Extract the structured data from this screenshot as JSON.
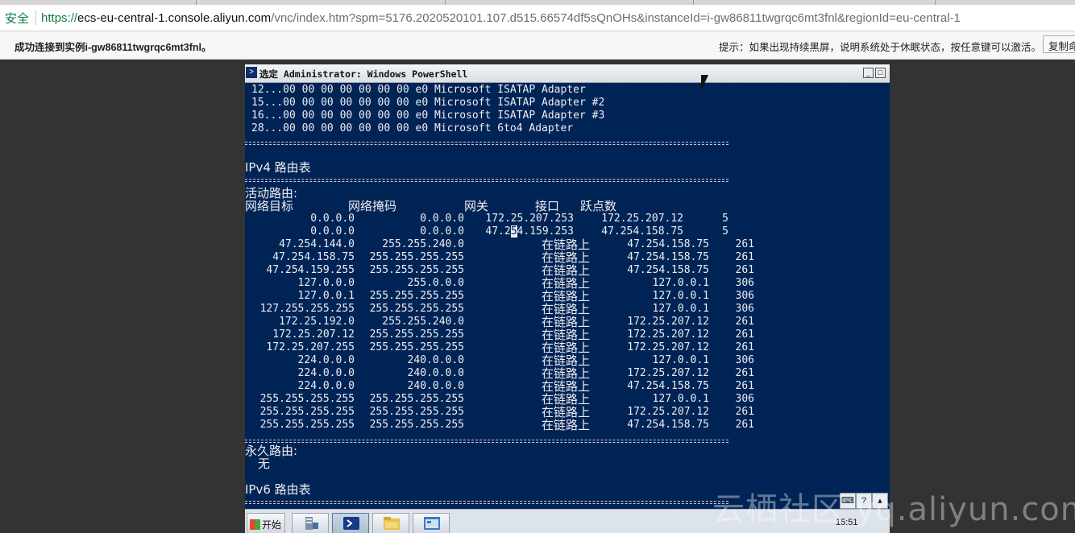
{
  "browser": {
    "secure_label": "安全",
    "url_scheme": "https://",
    "url_host": "ecs-eu-central-1.console.aliyun.com",
    "url_rest": "/vnc/index.htm?spm=5176.2020520101.107.d515.66574df5sQnOHs&instanceId=i-gw86811twgrqc6mt3fnl&regionId=eu-central-1"
  },
  "infobar": {
    "connected": "成功连接到实例i-gw86811twgrqc6mt3fnl。",
    "tip": "提示：如果出现持续黑屏，说明系统处于休眠状态，按任意键可以激活。",
    "copy_button": "复制命令"
  },
  "powershell": {
    "title": "选定 Administrator: Windows PowerShell",
    "adapters": [
      "12...00 00 00 00 00 00 00 e0 Microsoft ISATAP Adapter",
      "15...00 00 00 00 00 00 00 e0 Microsoft ISATAP Adapter #2",
      "16...00 00 00 00 00 00 00 e0 Microsoft ISATAP Adapter #3",
      "28...00 00 00 00 00 00 00 e0 Microsoft 6to4 Adapter"
    ],
    "separator": "===========================================================================",
    "ipv4_title": "IPv4 路由表",
    "active_routes": "活动路由:",
    "headers": {
      "dest": "网络目标",
      "mask": "网络掩码",
      "gateway": "网关",
      "iface": "接口",
      "metric": "跃点数"
    },
    "default_routes": [
      {
        "dest": "0.0.0.0",
        "mask": "0.0.0.0",
        "gateway": "172.25.207.253",
        "iface": "172.25.207.12",
        "metric": "5"
      },
      {
        "dest": "0.0.0.0",
        "mask": "0.0.0.0",
        "gateway_before": "47.2",
        "gateway_cursor": "5",
        "gateway_after": "4.159.253",
        "iface": "47.254.158.75",
        "metric": "5"
      }
    ],
    "onlink": "在链路上",
    "routes": [
      {
        "dest": "47.254.144.0",
        "mask": "255.255.240.0",
        "iface": "47.254.158.75",
        "metric": "261"
      },
      {
        "dest": "47.254.158.75",
        "mask": "255.255.255.255",
        "iface": "47.254.158.75",
        "metric": "261"
      },
      {
        "dest": "47.254.159.255",
        "mask": "255.255.255.255",
        "iface": "47.254.158.75",
        "metric": "261"
      },
      {
        "dest": "127.0.0.0",
        "mask": "255.0.0.0",
        "iface": "127.0.0.1",
        "metric": "306"
      },
      {
        "dest": "127.0.0.1",
        "mask": "255.255.255.255",
        "iface": "127.0.0.1",
        "metric": "306"
      },
      {
        "dest": "127.255.255.255",
        "mask": "255.255.255.255",
        "iface": "127.0.0.1",
        "metric": "306"
      },
      {
        "dest": "172.25.192.0",
        "mask": "255.255.240.0",
        "iface": "172.25.207.12",
        "metric": "261"
      },
      {
        "dest": "172.25.207.12",
        "mask": "255.255.255.255",
        "iface": "172.25.207.12",
        "metric": "261"
      },
      {
        "dest": "172.25.207.255",
        "mask": "255.255.255.255",
        "iface": "172.25.207.12",
        "metric": "261"
      },
      {
        "dest": "224.0.0.0",
        "mask": "240.0.0.0",
        "iface": "127.0.0.1",
        "metric": "306"
      },
      {
        "dest": "224.0.0.0",
        "mask": "240.0.0.0",
        "iface": "172.25.207.12",
        "metric": "261"
      },
      {
        "dest": "224.0.0.0",
        "mask": "240.0.0.0",
        "iface": "47.254.158.75",
        "metric": "261"
      },
      {
        "dest": "255.255.255.255",
        "mask": "255.255.255.255",
        "iface": "127.0.0.1",
        "metric": "306"
      },
      {
        "dest": "255.255.255.255",
        "mask": "255.255.255.255",
        "iface": "172.25.207.12",
        "metric": "261"
      },
      {
        "dest": "255.255.255.255",
        "mask": "255.255.255.255",
        "iface": "47.254.158.75",
        "metric": "261"
      }
    ],
    "persistent_routes": "永久路由:",
    "none": "无",
    "ipv6_title": "IPv6 路由表"
  },
  "taskbar": {
    "start": "开始",
    "clock": "15:51"
  },
  "watermark": "云栖社区 yq.aliyun.com",
  "colors": {
    "console_bg": "#012456",
    "console_fg": "#eeedf0",
    "secure_green": "#0b8043"
  }
}
